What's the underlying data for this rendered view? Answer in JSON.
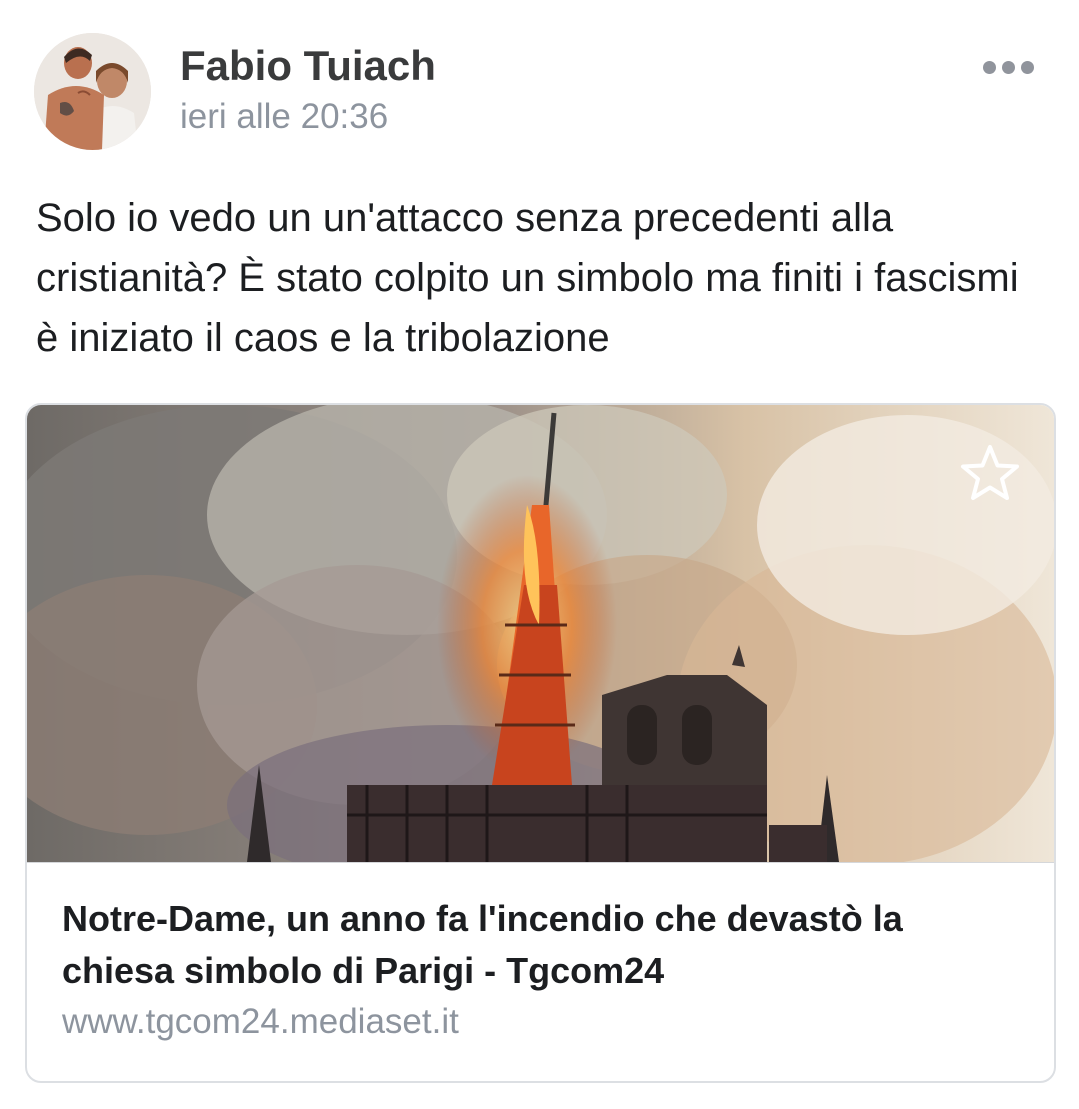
{
  "post": {
    "author": {
      "name": "Fabio Tuiach",
      "avatar_icon": "profile-photo"
    },
    "timestamp": "ieri alle 20:36",
    "more_icon": "ellipsis-horizontal-icon",
    "text": "Solo io vedo un un'attacco senza precedenti alla cristianità? È stato colpito un simbolo ma finiti i fascismi è iniziato il caos e la tribolazione"
  },
  "link_preview": {
    "image_subject": "notre-dame-fire-photo",
    "save_icon": "star-outline-icon",
    "title": "Notre-Dame, un anno fa l'incendio che devastò la chiesa simbolo di Parigi - Tgcom24",
    "domain": "www.tgcom24.mediaset.it"
  },
  "colors": {
    "secondary_text": "#8d949e",
    "primary_text": "#1c1e21",
    "card_border": "#dcdfe3"
  }
}
